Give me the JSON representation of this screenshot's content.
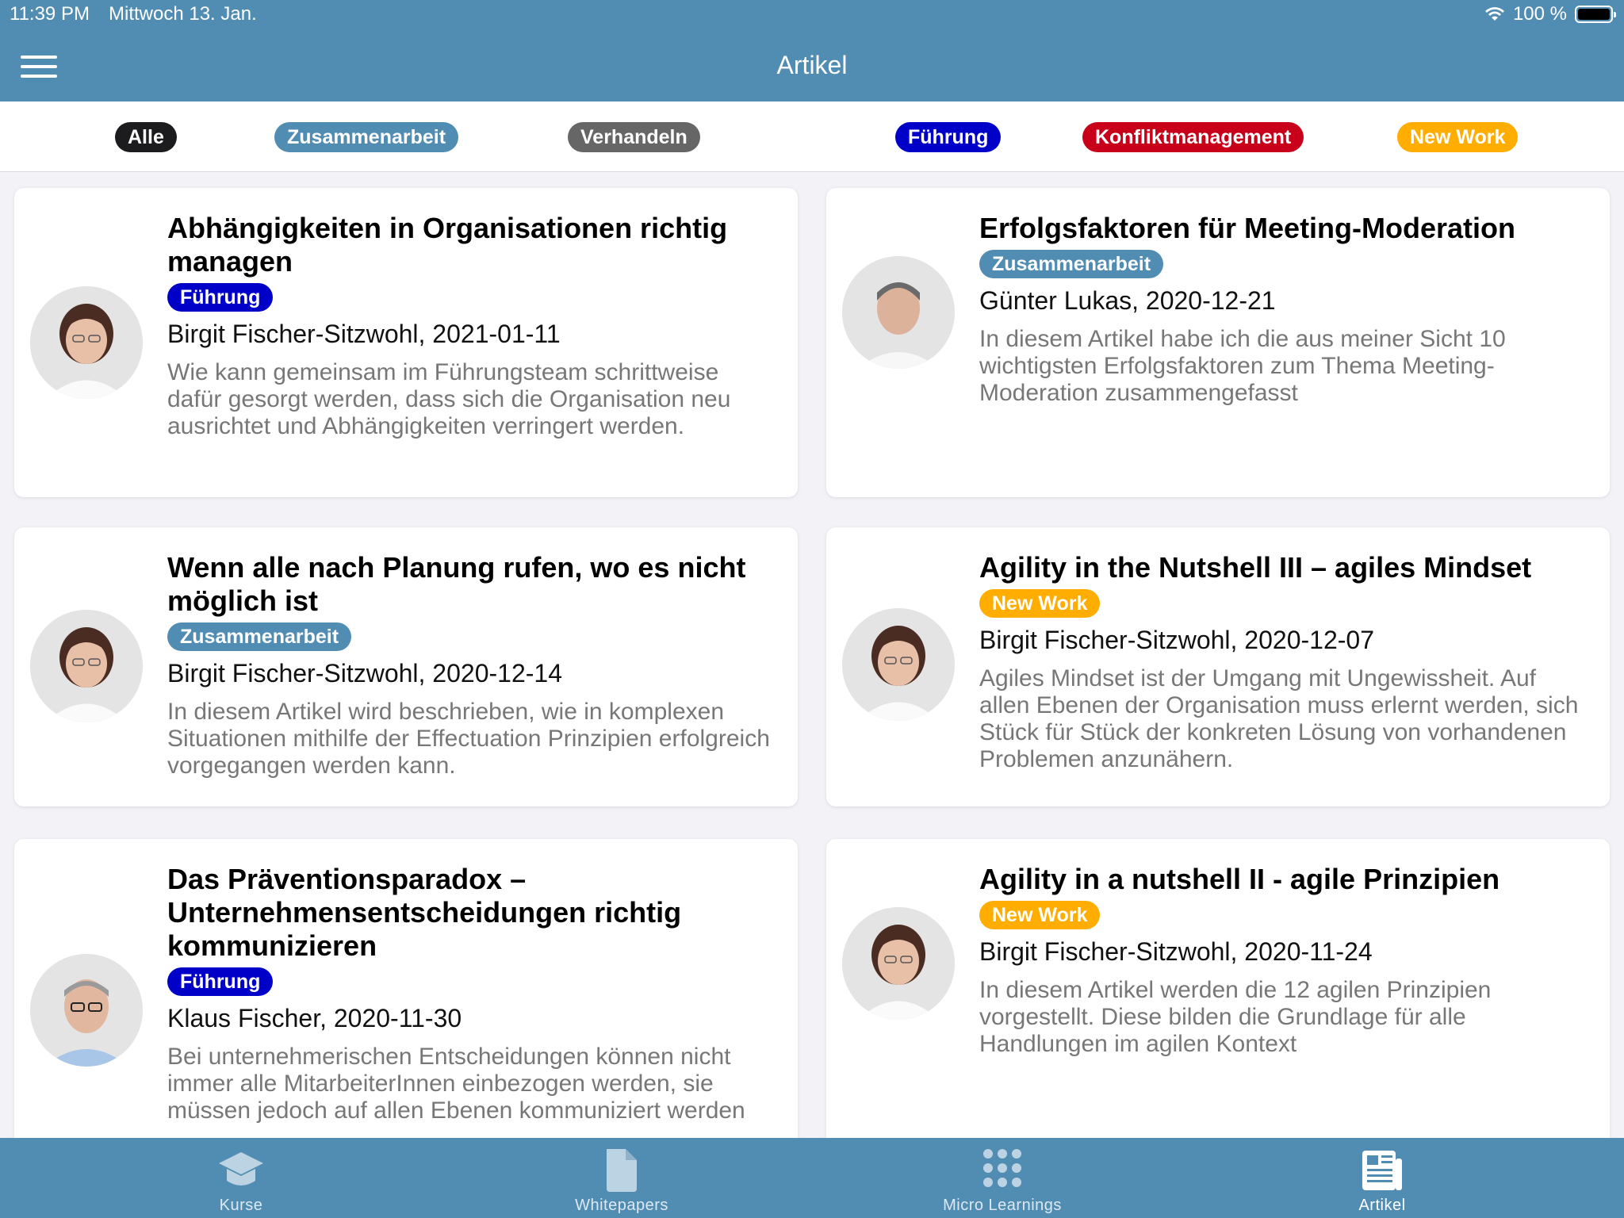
{
  "status": {
    "time": "11:39 PM",
    "date": "Mittwoch 13. Jan.",
    "battery": "100 %"
  },
  "header": {
    "title": "Artikel"
  },
  "colors": {
    "header": "#518cb3",
    "tags": {
      "Alle": "#1c1c1e",
      "Zusammenarbeit": "#518cb3",
      "Verhandeln": "#666666",
      "Führung": "#0000c8",
      "Konfliktmanagement": "#c8001a",
      "New Work": "#ffad00"
    }
  },
  "filters": [
    "Alle",
    "Zusammenarbeit",
    "Verhandeln",
    "Führung",
    "Konfliktmanagement",
    "New Work"
  ],
  "articles": [
    {
      "title": "Abhängigkeiten in Organisationen richtig managen",
      "tag": "Führung",
      "meta": "Birgit Fischer-Sitzwohl, 2021-01-11",
      "description": "Wie kann gemeinsam im Führungsteam schrittweise dafür gesorgt werden, dass sich die Organisation neu ausrichtet und Abhängigkeiten verringert werden.",
      "avatar": "woman-portrait"
    },
    {
      "title": "Erfolgsfaktoren für Meeting-Moderation",
      "tag": "Zusammenarbeit",
      "meta": "Günter Lukas, 2020-12-21",
      "description": "In diesem Artikel habe ich die aus meiner Sicht 10 wichtigsten Erfolgsfaktoren zum Thema Meeting-Moderation zusammengefasst",
      "avatar": "man-portrait"
    },
    {
      "title": "Wenn alle nach Planung rufen, wo es nicht möglich ist",
      "tag": "Zusammenarbeit",
      "meta": "Birgit Fischer-Sitzwohl, 2020-12-14",
      "description": "In diesem Artikel wird beschrieben, wie in komplexen Situationen mithilfe der Effectuation Prinzipien erfolgreich vorgegangen werden kann.",
      "avatar": "woman-portrait"
    },
    {
      "title": "Agility in the Nutshell III – agiles Mindset",
      "tag": "New Work",
      "meta": "Birgit Fischer-Sitzwohl, 2020-12-07",
      "description": "Agiles Mindset ist der Umgang mit Ungewissheit. Auf allen Ebenen der Organisation muss erlernt werden, sich Stück für Stück der konkreten Lösung von vorhandenen Problemen anzunähern.",
      "avatar": "woman-portrait"
    },
    {
      "title": "Das Präventionsparadox – Unternehmensentscheidungen richtig kommunizieren",
      "tag": "Führung",
      "meta": "Klaus Fischer, 2020-11-30",
      "description": "Bei unternehmerischen Entscheidungen können nicht immer alle MitarbeiterInnen einbezogen werden, sie müssen jedoch auf allen Ebenen kommuniziert werden",
      "avatar": "man-glasses-portrait"
    },
    {
      "title": "Agility in a nutshell II - agile Prinzipien",
      "tag": "New Work",
      "meta": "Birgit Fischer-Sitzwohl, 2020-11-24",
      "description": "In diesem Artikel werden die 12 agilen Prinzipien vorgestellt. Diese bilden die Grundlage für alle Handlungen im agilen Kontext",
      "avatar": "woman-portrait"
    }
  ],
  "tabs": [
    {
      "label": "Kurse",
      "icon": "graduation-cap-icon",
      "active": false
    },
    {
      "label": "Whitepapers",
      "icon": "document-icon",
      "active": false
    },
    {
      "label": "Micro Learnings",
      "icon": "dots-grid-icon",
      "active": false
    },
    {
      "label": "Artikel",
      "icon": "newspaper-icon",
      "active": true
    }
  ]
}
